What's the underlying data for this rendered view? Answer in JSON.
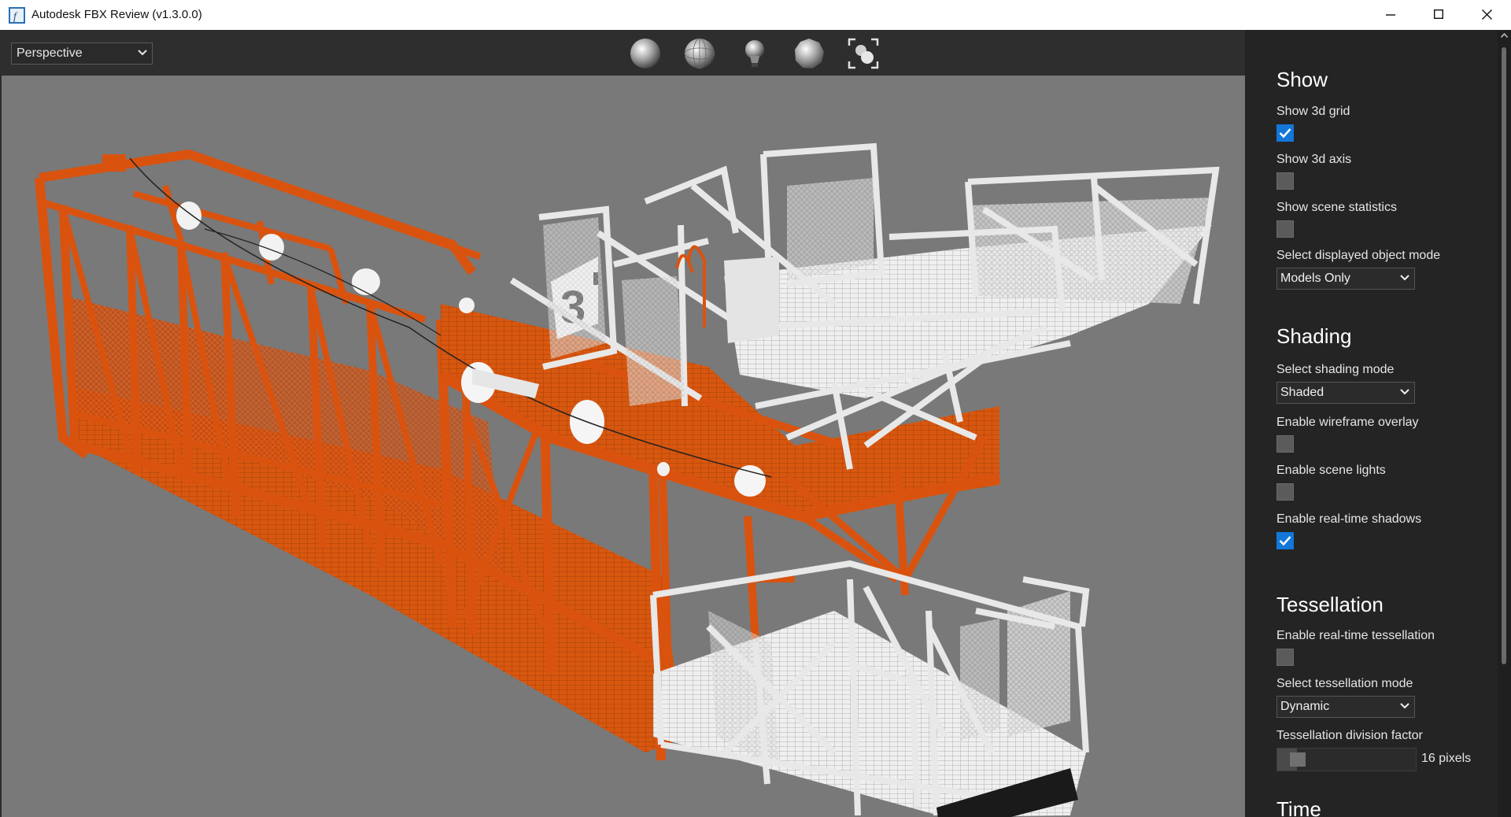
{
  "window": {
    "title": "Autodesk FBX Review (v1.3.0.0)"
  },
  "viewport": {
    "camera": "Perspective",
    "toolbar": [
      "sphere-shaded-icon",
      "sphere-wireframe-icon",
      "light-bulb-icon",
      "sphere-faceted-icon",
      "frame-all-icon"
    ],
    "scene_label": "3"
  },
  "panel": {
    "show": {
      "title": "Show",
      "grid": {
        "label": "Show 3d grid",
        "checked": true
      },
      "axis": {
        "label": "Show 3d axis",
        "checked": false
      },
      "stats": {
        "label": "Show scene statistics",
        "checked": false
      },
      "object_mode": {
        "label": "Select displayed object mode",
        "value": "Models Only"
      }
    },
    "shading": {
      "title": "Shading",
      "mode": {
        "label": "Select shading mode",
        "value": "Shaded"
      },
      "wireframe": {
        "label": "Enable wireframe overlay",
        "checked": false
      },
      "lights": {
        "label": "Enable scene lights",
        "checked": false
      },
      "shadows": {
        "label": "Enable real-time shadows",
        "checked": true
      }
    },
    "tessellation": {
      "title": "Tessellation",
      "enable": {
        "label": "Enable real-time tessellation",
        "checked": false
      },
      "mode": {
        "label": "Select tessellation mode",
        "value": "Dynamic"
      },
      "factor": {
        "label": "Tessellation division factor",
        "value_text": "16 pixels"
      }
    },
    "time": {
      "title": "Time"
    }
  },
  "colors": {
    "accent": "#1277d8",
    "scaffold_orange": "#d9530f",
    "scaffold_white": "#e8e8e8"
  }
}
